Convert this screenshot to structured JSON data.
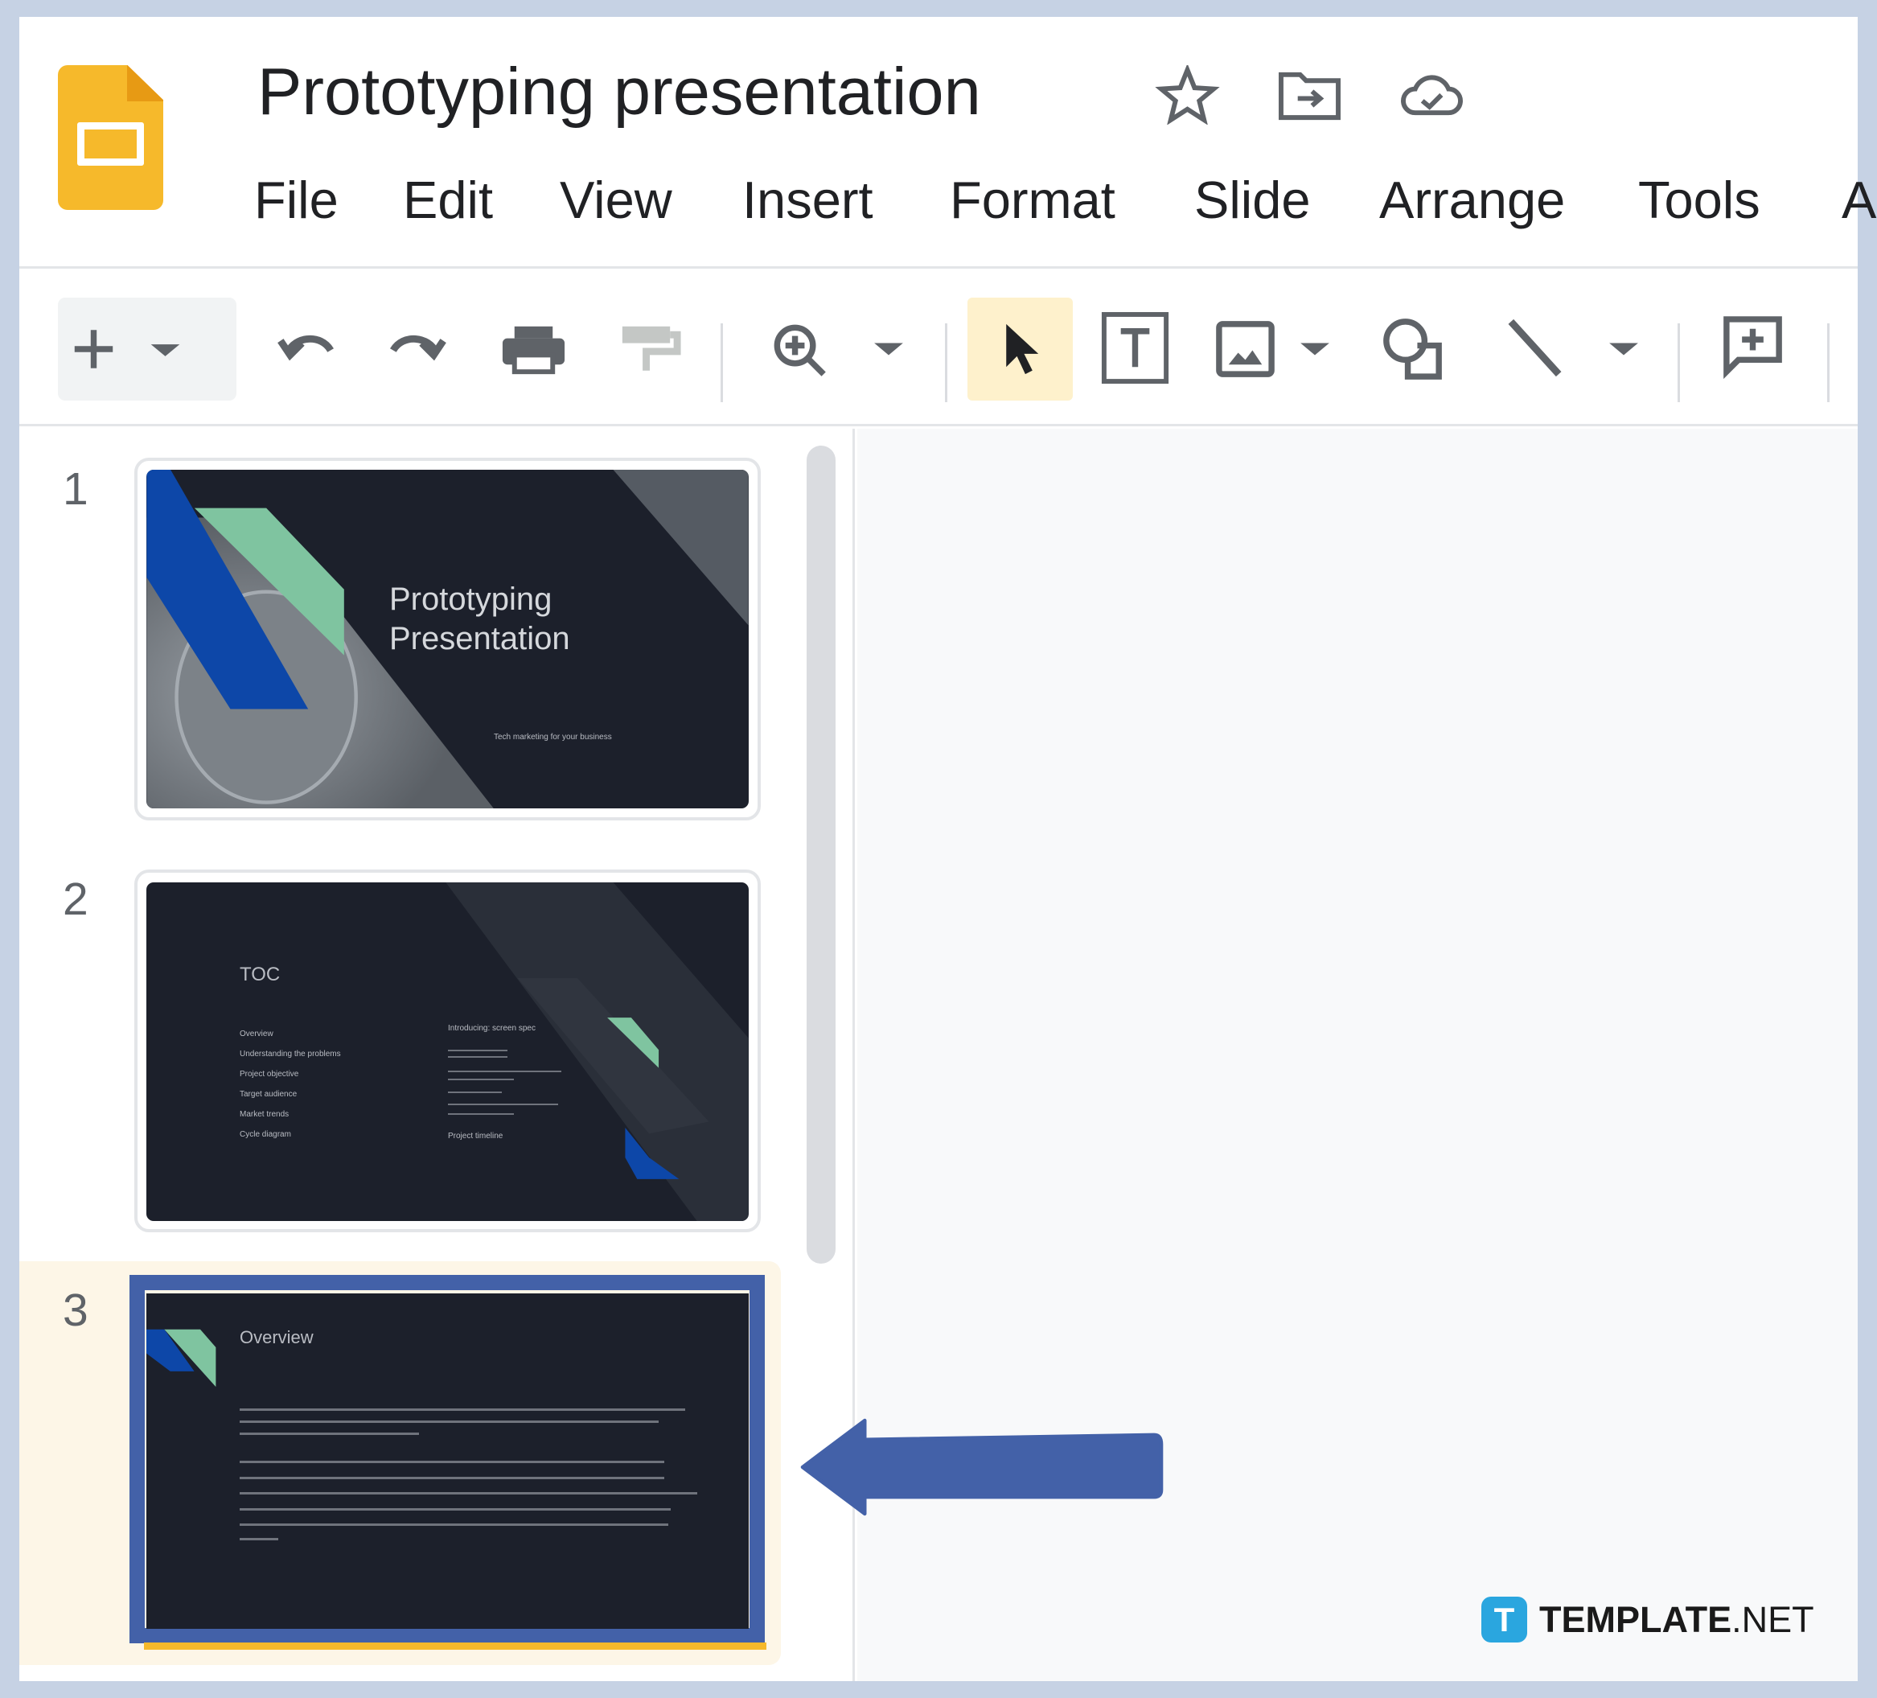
{
  "app": {
    "title": "Prototyping presentation"
  },
  "menu": [
    "File",
    "Edit",
    "View",
    "Insert",
    "Format",
    "Slide",
    "Arrange",
    "Tools",
    "A"
  ],
  "slides": [
    {
      "number": "1",
      "title_line1": "Prototyping",
      "title_line2": "Presentation",
      "subtitle": "Tech marketing for your business"
    },
    {
      "number": "2",
      "title": "TOC",
      "left_items": [
        "Overview",
        "Understanding the problems",
        "Project objective",
        "Target audience",
        "Market trends",
        "Cycle diagram"
      ],
      "right_items": [
        "Introducing: screen spec",
        "Project timeline"
      ]
    },
    {
      "number": "3",
      "title": "Overview",
      "selected": true
    }
  ],
  "watermark": {
    "logo_letter": "T",
    "brand": "TEMPLATE",
    "suffix": ".NET"
  },
  "colors": {
    "accent": "#4361a8",
    "logo": "#f6b92b",
    "select_highlight": "#fef1cc",
    "slide_bg": "#1c202b",
    "green": "#7fc4a0",
    "blue": "#0d47a8"
  }
}
